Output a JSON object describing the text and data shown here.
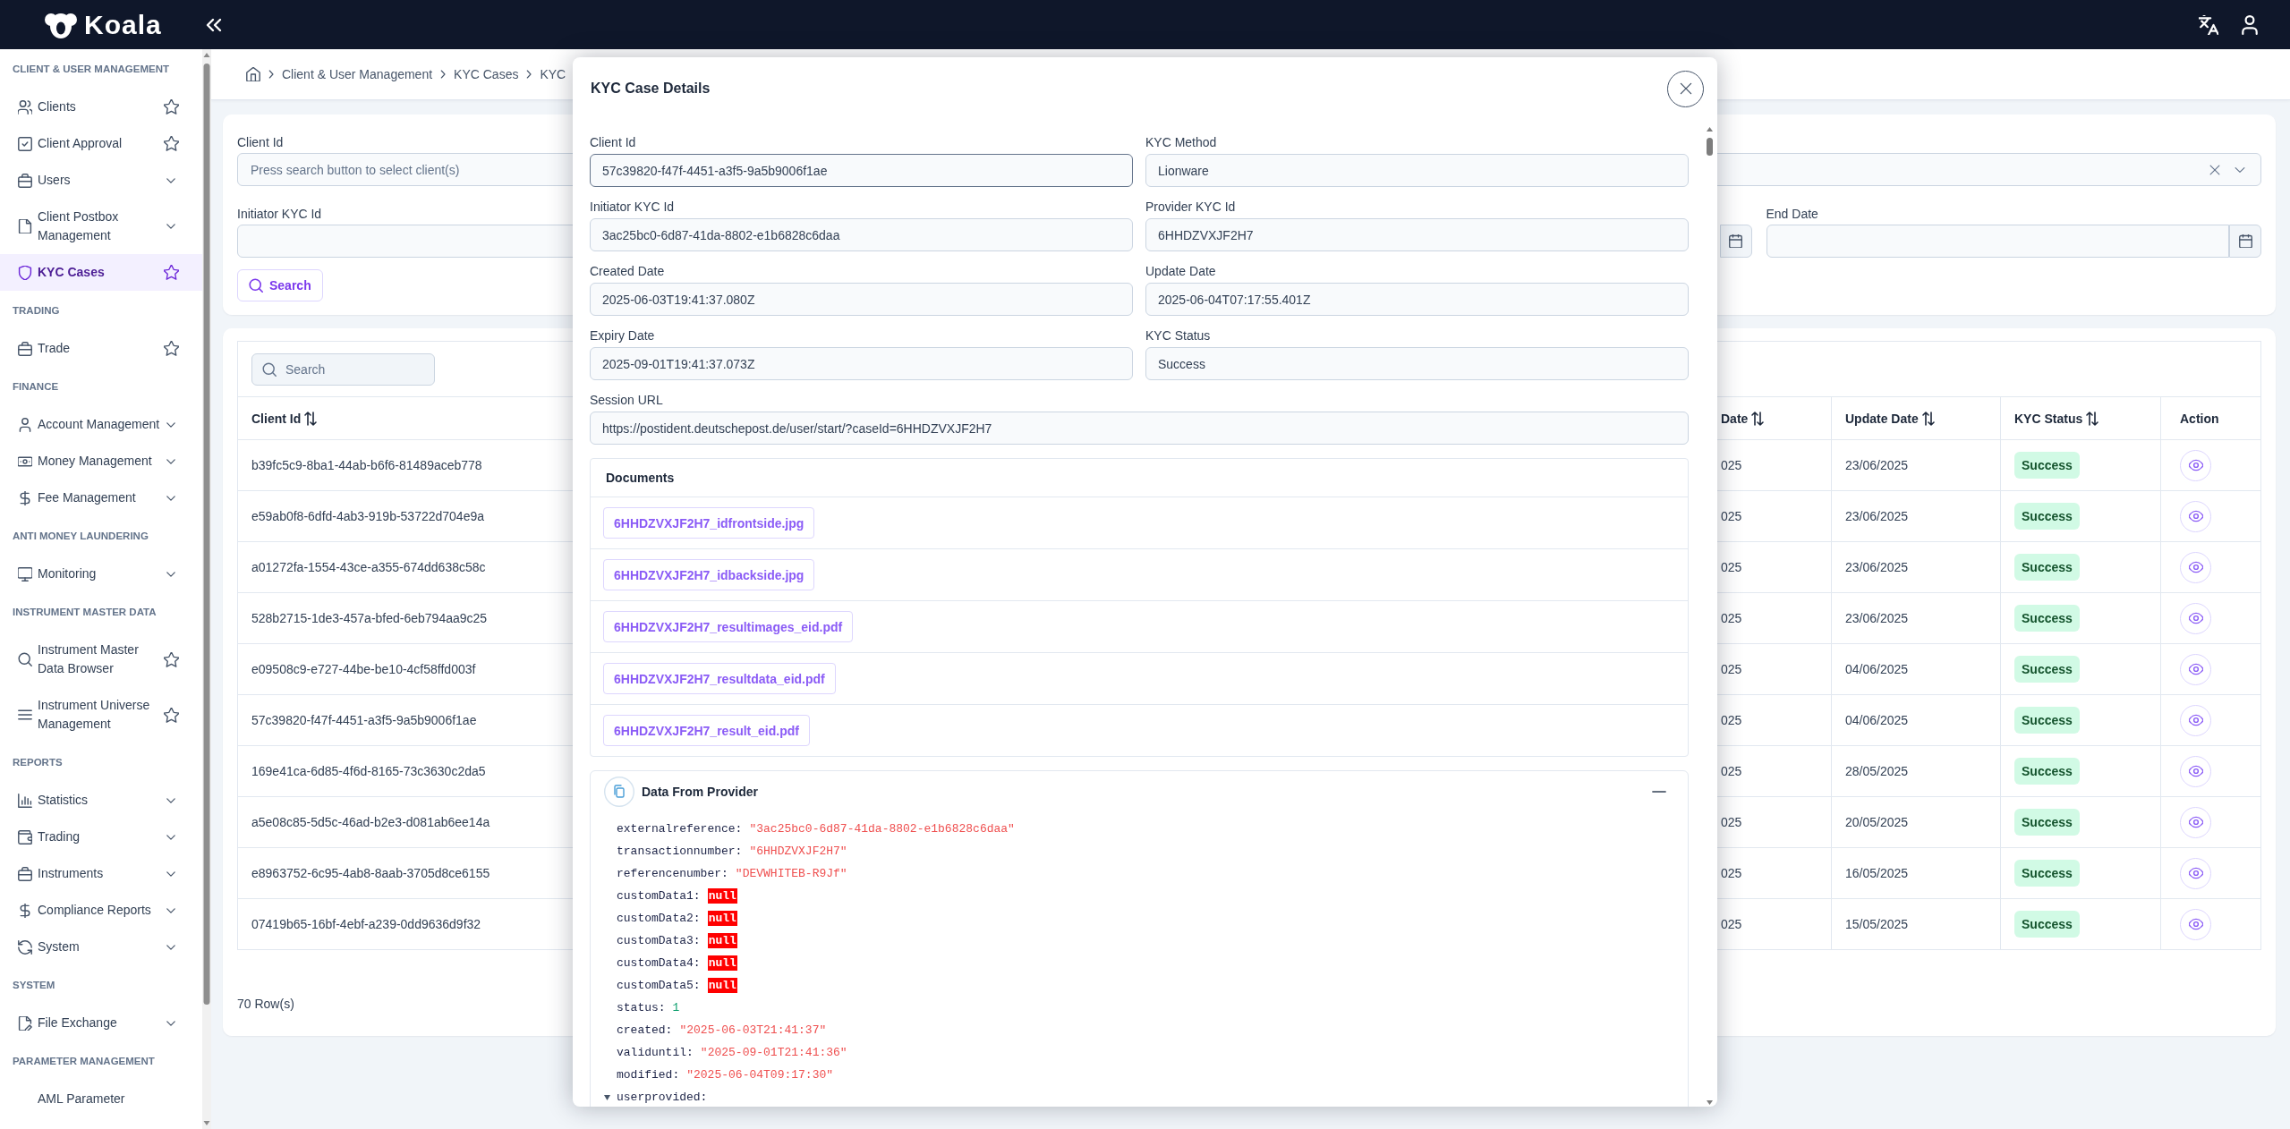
{
  "top_bar": {
    "logo": "Koala"
  },
  "sidebar": {
    "sections": [
      {
        "title": "CLIENT & USER MANAGEMENT",
        "items": [
          {
            "label": "Clients",
            "kind": "page",
            "selected": false
          },
          {
            "label": "Client Approval",
            "kind": "page",
            "selected": false
          },
          {
            "label": "Users",
            "kind": "group",
            "selected": false
          },
          {
            "label": "Client Postbox Management",
            "kind": "group",
            "selected": false
          },
          {
            "label": "KYC Cases",
            "kind": "page",
            "selected": true
          }
        ]
      },
      {
        "title": "TRADING",
        "items": [
          {
            "label": "Trade",
            "kind": "page",
            "selected": false
          }
        ]
      },
      {
        "title": "FINANCE",
        "items": [
          {
            "label": "Account Management",
            "kind": "group",
            "selected": false
          },
          {
            "label": "Money Management",
            "kind": "group",
            "selected": false
          },
          {
            "label": "Fee Management",
            "kind": "group",
            "selected": false
          }
        ]
      },
      {
        "title": "ANTI MONEY LAUNDERING",
        "items": [
          {
            "label": "Monitoring",
            "kind": "group",
            "selected": false
          }
        ]
      },
      {
        "title": "INSTRUMENT MASTER DATA",
        "items": [
          {
            "label": "Instrument Master Data Browser",
            "kind": "page",
            "selected": false
          },
          {
            "label": "Instrument Universe Management",
            "kind": "page",
            "selected": false
          }
        ]
      },
      {
        "title": "REPORTS",
        "items": [
          {
            "label": "Statistics",
            "kind": "group",
            "selected": false
          },
          {
            "label": "Trading",
            "kind": "group",
            "selected": false
          },
          {
            "label": "Instruments",
            "kind": "group",
            "selected": false
          },
          {
            "label": "Compliance Reports",
            "kind": "group",
            "selected": false
          },
          {
            "label": "System",
            "kind": "group",
            "selected": false
          }
        ]
      },
      {
        "title": "SYSTEM",
        "items": [
          {
            "label": "File Exchange",
            "kind": "group",
            "selected": false
          }
        ]
      },
      {
        "title": "PARAMETER MANAGEMENT",
        "items": [
          {
            "label": "AML Parameter",
            "kind": "item",
            "selected": false
          }
        ]
      }
    ]
  },
  "breadcrumb": [
    "Client & User Management",
    "KYC Cases",
    "KYC"
  ],
  "filters": {
    "fields": [
      {
        "kind": "text",
        "label": "Client Id",
        "placeholder": "Press search button to select client(s)"
      },
      {
        "kind": "select"
      },
      {
        "kind": "text",
        "label": "Initiator KYC Id"
      },
      {
        "kind": "date"
      },
      {
        "kind": "date",
        "label": "End Date"
      }
    ],
    "search_button": "Search"
  },
  "table": {
    "search": {
      "placeholder": "Search"
    },
    "columns": [
      {
        "label": "Client Id",
        "kind": "text",
        "sortable": true
      },
      {
        "label": "Date",
        "kind": "text",
        "sortable": true
      },
      {
        "label": "Update Date",
        "kind": "text",
        "sortable": true
      },
      {
        "label": "KYC Status",
        "kind": "status",
        "sortable": true
      },
      {
        "label": "Action",
        "kind": "action",
        "sortable": false
      }
    ],
    "rows": [
      {
        "cells": [
          "b39fc5c9-8ba1-44ab-b6f6-81489aceb778",
          "025",
          "23/06/2025",
          "Success"
        ]
      },
      {
        "cells": [
          "e59ab0f8-6dfd-4ab3-919b-53722d704e9a",
          "025",
          "23/06/2025",
          "Success"
        ]
      },
      {
        "cells": [
          "a01272fa-1554-43ce-a355-674dd638c58c",
          "025",
          "23/06/2025",
          "Success"
        ]
      },
      {
        "cells": [
          "528b2715-1de3-457a-bfed-6eb794aa9c25",
          "025",
          "23/06/2025",
          "Success"
        ]
      },
      {
        "cells": [
          "e09508c9-e727-44be-be10-4cf58ffd003f",
          "025",
          "04/06/2025",
          "Success"
        ]
      },
      {
        "cells": [
          "57c39820-f47f-4451-a3f5-9a5b9006f1ae",
          "025",
          "04/06/2025",
          "Success"
        ]
      },
      {
        "cells": [
          "169e41ca-6d85-4f6d-8165-73c3630c2da5",
          "025",
          "28/05/2025",
          "Success"
        ]
      },
      {
        "cells": [
          "a5e08c85-5d5c-46ad-b2e3-d081ab6ee14a",
          "025",
          "20/05/2025",
          "Success"
        ]
      },
      {
        "cells": [
          "e8963752-6c95-4ab8-8aab-3705d8ce6155",
          "025",
          "16/05/2025",
          "Success"
        ]
      },
      {
        "cells": [
          "07419b65-16bf-4ebf-a239-0dd9636d9f32",
          "025",
          "15/05/2025",
          "Success"
        ]
      }
    ],
    "row_count": "70 Row(s)"
  },
  "modal": {
    "title": "KYC Case Details",
    "fields": [
      {
        "label": "Client Id",
        "value": "57c39820-f47f-4451-a3f5-9a5b9006f1ae",
        "focused": true
      },
      {
        "label": "KYC Method",
        "value": "Lionware",
        "focused": false
      },
      {
        "label": "Initiator KYC Id",
        "value": "3ac25bc0-6d87-41da-8802-e1b6828c6daa",
        "focused": false
      },
      {
        "label": "Provider KYC Id",
        "value": "6HHDZVXJF2H7",
        "focused": false
      },
      {
        "label": "Created Date",
        "value": "2025-06-03T19:41:37.080Z",
        "focused": false
      },
      {
        "label": "Update Date",
        "value": "2025-06-04T07:17:55.401Z",
        "focused": false
      },
      {
        "label": "Expiry Date",
        "value": "2025-09-01T19:41:37.073Z",
        "focused": false
      },
      {
        "label": "KYC Status",
        "value": "Success",
        "focused": false
      }
    ],
    "session_url": {
      "label": "Session URL",
      "value": "https://postident.deutschepost.de/user/start/?caseId=6HHDZVXJF2H7",
      "focused": false
    },
    "documents": {
      "title": "Documents",
      "files": [
        "6HHDZVXJF2H7_idfrontside.jpg",
        "6HHDZVXJF2H7_idbackside.jpg",
        "6HHDZVXJF2H7_resultimages_eid.pdf",
        "6HHDZVXJF2H7_resultdata_eid.pdf",
        "6HHDZVXJF2H7_result_eid.pdf"
      ]
    },
    "provider_data": {
      "title": "Data From Provider",
      "expanded": true,
      "entries": [
        {
          "key": "externalreference:",
          "value": "\"3ac25bc0-6d87-41da-8802-e1b6828c6daa\"",
          "kind": "string"
        },
        {
          "key": "transactionnumber:",
          "value": "\"6HHDZVXJF2H7\"",
          "kind": "string"
        },
        {
          "key": "referencenumber:",
          "value": "\"DEVWHITEB-R9Jf\"",
          "kind": "string"
        },
        {
          "key": "customData1:",
          "value": "null",
          "kind": "null"
        },
        {
          "key": "customData2:",
          "value": "null",
          "kind": "null"
        },
        {
          "key": "customData3:",
          "value": "null",
          "kind": "null"
        },
        {
          "key": "customData4:",
          "value": "null",
          "kind": "null"
        },
        {
          "key": "customData5:",
          "value": "null",
          "kind": "null"
        },
        {
          "key": "status:",
          "value": "1",
          "kind": "number"
        },
        {
          "key": "created:",
          "value": "\"2025-06-03T21:41:37\"",
          "kind": "string"
        },
        {
          "key": "validuntil:",
          "value": "\"2025-09-01T21:41:36\"",
          "kind": "string"
        },
        {
          "key": "modified:",
          "value": "\"2025-06-04T09:17:30\"",
          "kind": "string"
        },
        {
          "key": "userprovided:",
          "kind": "object"
        }
      ]
    }
  }
}
